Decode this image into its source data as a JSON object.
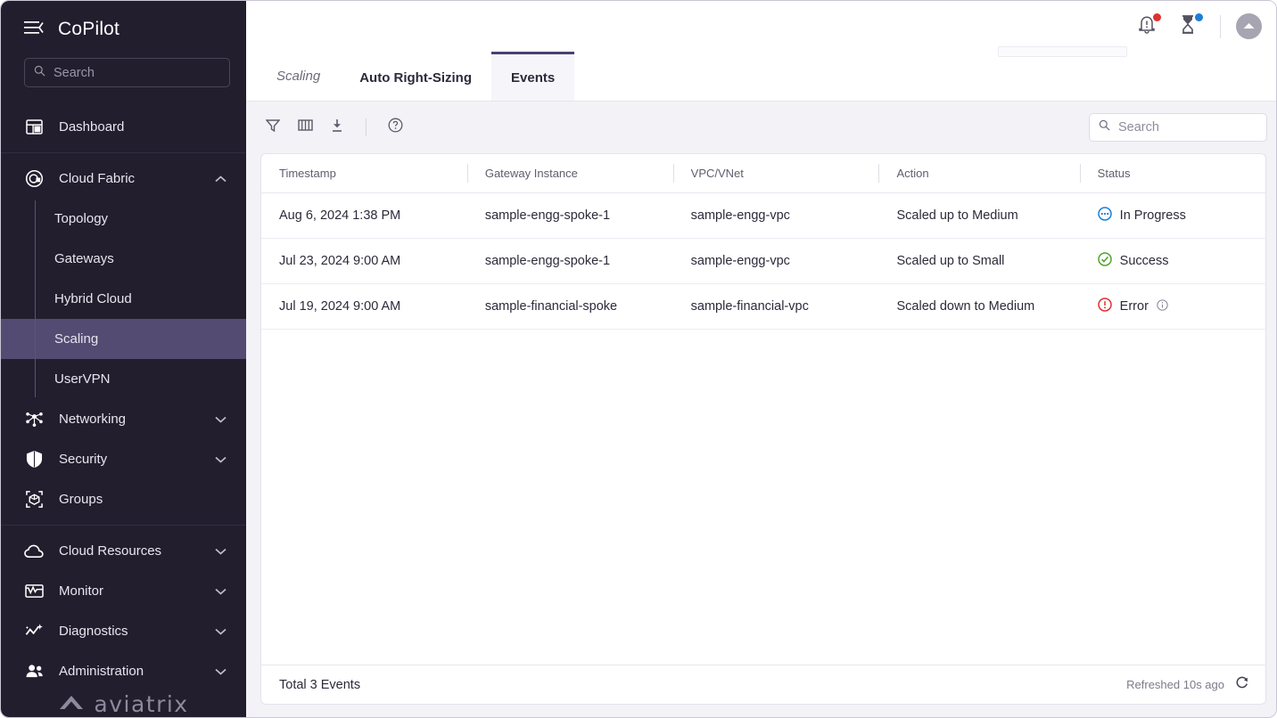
{
  "sidebar": {
    "brand": "CoPilot",
    "menu_icon": "hamburger-collapse-icon",
    "search": {
      "placeholder": "Search",
      "icon": "search-icon"
    },
    "items": [
      {
        "label": "Dashboard",
        "icon": "dashboard-grid-icon",
        "expandable": false
      },
      {
        "label": "Cloud Fabric",
        "icon": "cloud-fabric-target-icon",
        "expandable": true,
        "expanded": true
      },
      {
        "label": "Networking",
        "icon": "networking-nodes-icon",
        "expandable": true,
        "expanded": false
      },
      {
        "label": "Security",
        "icon": "shield-icon",
        "expandable": true,
        "expanded": false
      },
      {
        "label": "Groups",
        "icon": "groups-cube-icon",
        "expandable": false
      },
      {
        "label": "Cloud Resources",
        "icon": "cloud-icon",
        "expandable": true,
        "expanded": false
      },
      {
        "label": "Monitor",
        "icon": "monitor-pulse-icon",
        "expandable": true,
        "expanded": false
      },
      {
        "label": "Diagnostics",
        "icon": "diagnostics-sparkle-icon",
        "expandable": true,
        "expanded": false
      },
      {
        "label": "Administration",
        "icon": "users-icon",
        "expandable": true,
        "expanded": false
      }
    ],
    "submenu": [
      {
        "label": "Topology",
        "active": false
      },
      {
        "label": "Gateways",
        "active": false
      },
      {
        "label": "Hybrid Cloud",
        "active": false
      },
      {
        "label": "Scaling",
        "active": true
      },
      {
        "label": "UserVPN",
        "active": false
      }
    ],
    "logo": "aviatrix",
    "active_highlight_color": "#544b72",
    "background_color": "#221e2e"
  },
  "topbar": {
    "notifications": {
      "icon": "bell-alert-icon",
      "badge_color": "#e03131"
    },
    "tasks": {
      "icon": "hourglass-icon",
      "badge_color": "#1c7ed6"
    },
    "account": {
      "icon": "chevron-up-icon"
    }
  },
  "tabs": {
    "page_label": "Scaling",
    "items": [
      {
        "label": "Auto Right-Sizing",
        "active": false
      },
      {
        "label": "Events",
        "active": true
      }
    ],
    "active_underline_color": "#4b3f72"
  },
  "toolbar": {
    "filter": "filter-funnel-icon",
    "columns": "columns-icon",
    "download": "download-icon",
    "help": "help-circle-icon",
    "search": {
      "placeholder": "Search",
      "icon": "search-icon"
    }
  },
  "table": {
    "columns": [
      "Timestamp",
      "Gateway Instance",
      "VPC/VNet",
      "Action",
      "Status"
    ],
    "rows": [
      {
        "timestamp": "Aug 6, 2024 1:38 PM",
        "gateway_instance": "sample-engg-spoke-1",
        "vpc_vnet": "sample-engg-vpc",
        "action": "Scaled up to Medium",
        "status": "In Progress",
        "status_kind": "in-progress",
        "status_color": "#1c7ed6",
        "has_info": false
      },
      {
        "timestamp": "Jul 23, 2024 9:00 AM",
        "gateway_instance": "sample-engg-spoke-1",
        "vpc_vnet": "sample-engg-vpc",
        "action": "Scaled up to Small",
        "status": "Success",
        "status_kind": "success",
        "status_color": "#51a32a",
        "has_info": false
      },
      {
        "timestamp": "Jul 19, 2024 9:00 AM",
        "gateway_instance": "sample-financial-spoke",
        "vpc_vnet": "sample-financial-vpc",
        "action": "Scaled down to Medium",
        "status": "Error",
        "status_kind": "error",
        "status_color": "#e03131",
        "has_info": true
      }
    ]
  },
  "footer": {
    "total_label": "Total 3 Events",
    "refreshed_label": "Refreshed 10s ago",
    "refresh_icon": "refresh-icon"
  }
}
